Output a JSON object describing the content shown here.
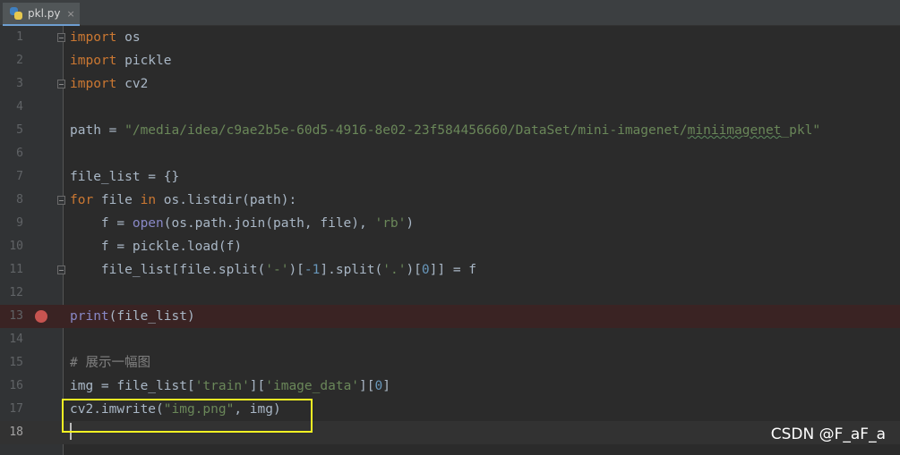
{
  "tab": {
    "filename": "pkl.py",
    "close": "×",
    "icon": "python-file-icon"
  },
  "editor": {
    "lines": [
      {
        "n": "1",
        "tokens": [
          [
            "kw",
            "import"
          ],
          [
            "t",
            " os"
          ]
        ]
      },
      {
        "n": "2",
        "tokens": [
          [
            "kw",
            "import"
          ],
          [
            "t",
            " pickle"
          ]
        ]
      },
      {
        "n": "3",
        "tokens": [
          [
            "kw",
            "import"
          ],
          [
            "t",
            " cv2"
          ]
        ]
      },
      {
        "n": "4",
        "tokens": []
      },
      {
        "n": "5",
        "tokens": [
          [
            "t",
            "path = "
          ],
          [
            "str",
            "\"/media/idea/c9ae2b5e-60d5-4916-8e02-23f584456660/DataSet/mini-imagenet/"
          ],
          [
            "sq",
            "miniimagenet"
          ],
          [
            "str",
            "_pkl\""
          ]
        ]
      },
      {
        "n": "6",
        "tokens": []
      },
      {
        "n": "7",
        "tokens": [
          [
            "t",
            "file_list = {}"
          ]
        ]
      },
      {
        "n": "8",
        "tokens": [
          [
            "kw",
            "for"
          ],
          [
            "t",
            " file "
          ],
          [
            "kw",
            "in"
          ],
          [
            "t",
            " os.listdir(path):"
          ]
        ]
      },
      {
        "n": "9",
        "tokens": [
          [
            "t",
            "    f = "
          ],
          [
            "bi",
            "open"
          ],
          [
            "t",
            "(os.path.join(path, file), "
          ],
          [
            "str",
            "'rb'"
          ],
          [
            "t",
            ")"
          ]
        ]
      },
      {
        "n": "10",
        "tokens": [
          [
            "t",
            "    f = pickle.load(f)"
          ]
        ]
      },
      {
        "n": "11",
        "tokens": [
          [
            "t",
            "    file_list[file.split("
          ],
          [
            "str",
            "'-'"
          ],
          [
            "t",
            ")["
          ],
          [
            "num",
            "-1"
          ],
          [
            "t",
            "].split("
          ],
          [
            "str",
            "'.'"
          ],
          [
            "t",
            ")["
          ],
          [
            "num",
            "0"
          ],
          [
            "t",
            "]] = f"
          ]
        ]
      },
      {
        "n": "12",
        "tokens": []
      },
      {
        "n": "13",
        "tokens": [
          [
            "bi",
            "print"
          ],
          [
            "t",
            "(file_list)"
          ]
        ]
      },
      {
        "n": "14",
        "tokens": []
      },
      {
        "n": "15",
        "tokens": [
          [
            "cmt",
            "# 展示一幅图"
          ]
        ]
      },
      {
        "n": "16",
        "tokens": [
          [
            "t",
            "img = file_list["
          ],
          [
            "str",
            "'train'"
          ],
          [
            "t",
            "]["
          ],
          [
            "str",
            "'image_data'"
          ],
          [
            "t",
            "]["
          ],
          [
            "num",
            "0"
          ],
          [
            "t",
            "]"
          ]
        ]
      },
      {
        "n": "17",
        "tokens": [
          [
            "t",
            "cv2.imwrite("
          ],
          [
            "str",
            "\"img.png\""
          ],
          [
            "t",
            ", img)"
          ]
        ]
      },
      {
        "n": "18",
        "tokens": [
          [
            "caret",
            ""
          ]
        ]
      }
    ],
    "breakpoint_line": 13,
    "current_line": 18,
    "highlighted_line": 17
  },
  "watermark": "CSDN @F_aF_a",
  "colors": {
    "background": "#2b2b2b",
    "keyword": "#cc7832",
    "string": "#6a8759",
    "number": "#6897bb",
    "comment": "#808080",
    "builtin": "#8888c6",
    "breakpoint": "#c75450",
    "highlight_box": "#f5f523"
  }
}
